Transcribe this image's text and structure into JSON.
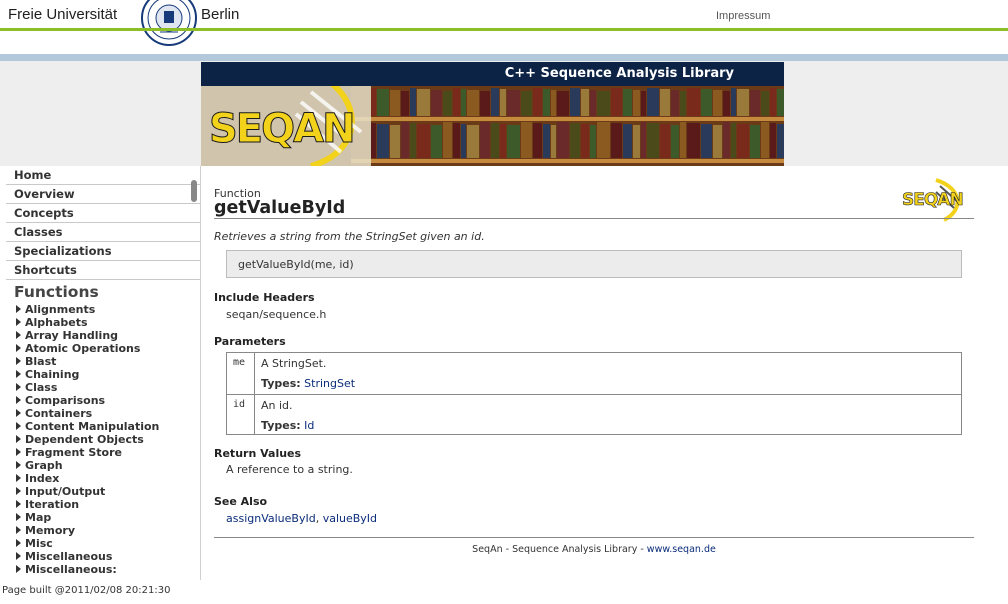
{
  "header": {
    "university_left": "Freie Universität",
    "university_right": "Berlin",
    "impressum": "Impressum"
  },
  "banner": {
    "title": "C++ Sequence Analysis Library",
    "logo_text": "SEQAN"
  },
  "sidebar": {
    "nav": [
      {
        "label": "Home"
      },
      {
        "label": "Overview"
      },
      {
        "label": "Concepts"
      },
      {
        "label": "Classes"
      },
      {
        "label": "Specializations"
      },
      {
        "label": "Shortcuts"
      }
    ],
    "functions_heading": "Functions",
    "functions": [
      "Alignments",
      "Alphabets",
      "Array Handling",
      "Atomic Operations",
      "Blast",
      "Chaining",
      "Class",
      "Comparisons",
      "Containers",
      "Content Manipulation",
      "Dependent Objects",
      "Fragment Store",
      "Graph",
      "Index",
      "Input/Output",
      "Iteration",
      "Map",
      "Memory",
      "Misc",
      "Miscellaneous",
      "Miscellaneous:"
    ]
  },
  "footer": {
    "built": "Page built @2011/02/08 20:21:30",
    "library": "SeqAn - Sequence Analysis Library - ",
    "library_link": "www.seqan.de"
  },
  "main": {
    "kind": "Function",
    "title": "getValueById",
    "logo_text": "SEQAN",
    "summary": "Retrieves a string from the StringSet given an id.",
    "signature": "getValueById(me, id)",
    "include_heading": "Include Headers",
    "include_value": "seqan/sequence.h",
    "parameters_heading": "Parameters",
    "parameters": [
      {
        "name": "me",
        "desc": "A StringSet.",
        "types_label": "Types:",
        "type": "StringSet"
      },
      {
        "name": "id",
        "desc": "An id.",
        "types_label": "Types:",
        "type": "Id"
      }
    ],
    "return_heading": "Return Values",
    "return_value": "A reference to a string.",
    "see_also_heading": "See Also",
    "see_also": [
      "assignValueById",
      "valueById"
    ],
    "see_also_sep": ", "
  },
  "colors": {
    "green_line": "#8cbf26",
    "blue_line": "#b4c8dc",
    "banner_bar": "#0d2345",
    "link": "#0a2c7a",
    "seqan_yellow": "#f2d21a"
  }
}
